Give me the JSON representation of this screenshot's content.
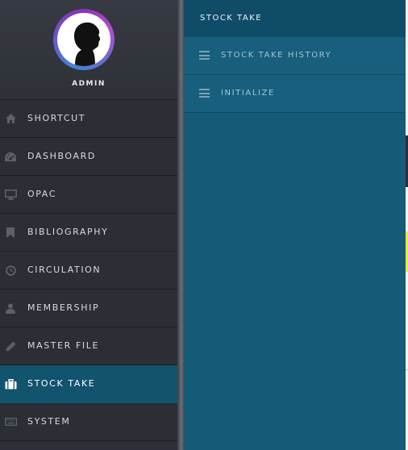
{
  "profile": {
    "name": "ADMIN",
    "avatar_icon": "user-silhouette-icon"
  },
  "sidebar": {
    "items": [
      {
        "label": "SHORTCUT",
        "icon": "home-icon"
      },
      {
        "label": "DASHBOARD",
        "icon": "dashboard-icon"
      },
      {
        "label": "OPAC",
        "icon": "desktop-icon"
      },
      {
        "label": "BIBLIOGRAPHY",
        "icon": "bookmark-icon"
      },
      {
        "label": "CIRCULATION",
        "icon": "clock-icon"
      },
      {
        "label": "MEMBERSHIP",
        "icon": "user-icon"
      },
      {
        "label": "MASTER FILE",
        "icon": "pencil-icon"
      },
      {
        "label": "STOCK TAKE",
        "icon": "briefcase-icon",
        "active": true
      },
      {
        "label": "SYSTEM",
        "icon": "keyboard-icon"
      }
    ]
  },
  "submenu": {
    "title": "STOCK TAKE",
    "items": [
      {
        "label": "STOCK TAKE HISTORY",
        "icon": "menu-lines-icon"
      },
      {
        "label": "INITIALIZE",
        "icon": "menu-lines-icon"
      }
    ]
  },
  "colors": {
    "sidebar_bg": "#2b2e35",
    "active_bg": "#12536e",
    "submenu_bg": "#155b78",
    "submenu_header_bg": "#0f4c68"
  }
}
